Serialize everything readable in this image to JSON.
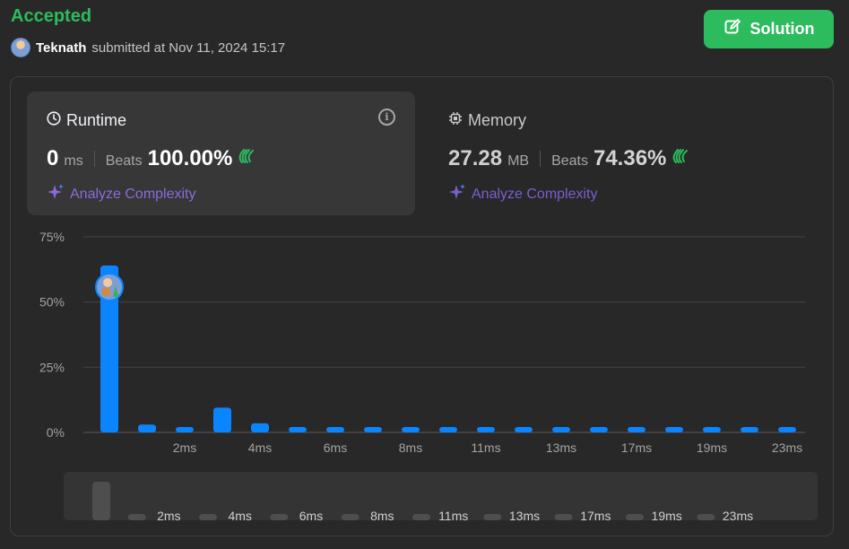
{
  "header": {
    "status": "Accepted",
    "username": "Teknath",
    "submitted_text": "submitted at Nov 11, 2024 15:17",
    "solution_label": "Solution",
    "status_color": "#2cbb5d"
  },
  "runtime": {
    "title": "Runtime",
    "value": "0",
    "unit": "ms",
    "beats_label": "Beats",
    "beats_value": "100.00%",
    "analyze_label": "Analyze Complexity"
  },
  "memory": {
    "title": "Memory",
    "value": "27.28",
    "unit": "MB",
    "beats_label": "Beats",
    "beats_value": "74.36%",
    "analyze_label": "Analyze Complexity"
  },
  "icons": {
    "solution": "edit-icon",
    "runtime": "clock-icon",
    "memory": "chip-icon",
    "info": "info-icon",
    "beats": "clap-icon",
    "analyze": "sparkle-icon"
  },
  "chart_data": {
    "type": "bar",
    "ylim": [
      0,
      75
    ],
    "yticks": [
      "0%",
      "25%",
      "50%",
      "75%"
    ],
    "ytick_values": [
      0,
      25,
      50,
      75
    ],
    "xtick_labels": [
      "2ms",
      "4ms",
      "6ms",
      "8ms",
      "11ms",
      "13ms",
      "17ms",
      "19ms",
      "23ms"
    ],
    "values": [
      64,
      3,
      2,
      9.5,
      3.5,
      2,
      2,
      2,
      2,
      2,
      2,
      2,
      2,
      2,
      2,
      2,
      2,
      2,
      2
    ],
    "highlight_index": 0,
    "bar_color": "#0a84ff",
    "grid": true,
    "minimap_xtick_labels": [
      "2ms",
      "4ms",
      "6ms",
      "8ms",
      "11ms",
      "13ms",
      "17ms",
      "19ms",
      "23ms"
    ]
  }
}
